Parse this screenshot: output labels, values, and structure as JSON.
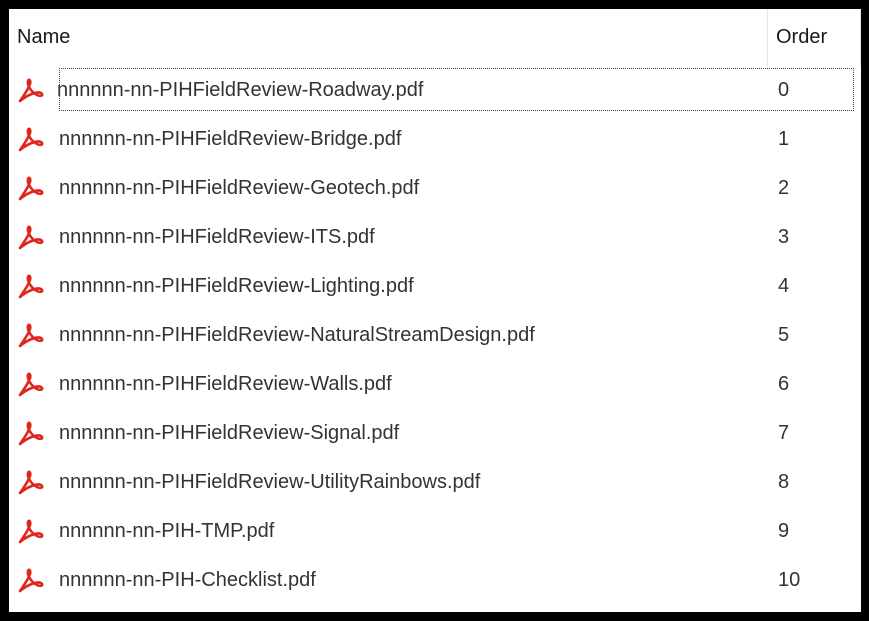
{
  "columns": {
    "name": "Name",
    "order": "Order"
  },
  "icon": "pdf-icon",
  "accent_color": "#e0261b",
  "files": [
    {
      "name": "nnnnnn-nn-PIHFieldReview-Roadway.pdf",
      "order": "0"
    },
    {
      "name": "nnnnnn-nn-PIHFieldReview-Bridge.pdf",
      "order": "1"
    },
    {
      "name": "nnnnnn-nn-PIHFieldReview-Geotech.pdf",
      "order": "2"
    },
    {
      "name": "nnnnnn-nn-PIHFieldReview-ITS.pdf",
      "order": "3"
    },
    {
      "name": "nnnnnn-nn-PIHFieldReview-Lighting.pdf",
      "order": "4"
    },
    {
      "name": "nnnnnn-nn-PIHFieldReview-NaturalStreamDesign.pdf",
      "order": "5"
    },
    {
      "name": "nnnnnn-nn-PIHFieldReview-Walls.pdf",
      "order": "6"
    },
    {
      "name": "nnnnnn-nn-PIHFieldReview-Signal.pdf",
      "order": "7"
    },
    {
      "name": "nnnnnn-nn-PIHFieldReview-UtilityRainbows.pdf",
      "order": "8"
    },
    {
      "name": "nnnnnn-nn-PIH-TMP.pdf",
      "order": "9"
    },
    {
      "name": "nnnnnn-nn-PIH-Checklist.pdf",
      "order": "10"
    }
  ]
}
